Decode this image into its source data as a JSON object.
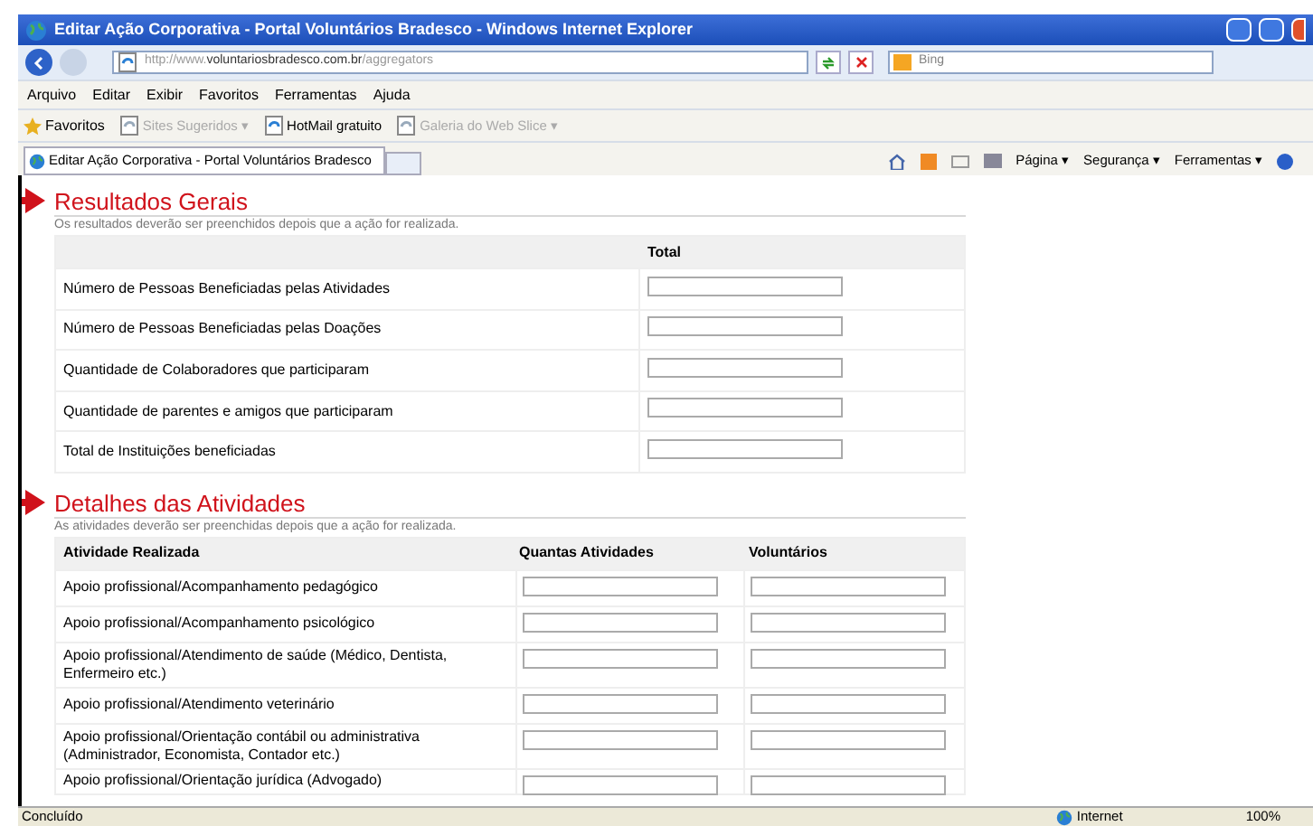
{
  "window": {
    "title": "Editar Ação Corporativa - Portal Voluntários Bradesco - Windows Internet Explorer"
  },
  "address": {
    "prefix": "http://www.",
    "domain": "voluntariosbradesco.com.br",
    "path": "/aggregators"
  },
  "search": {
    "placeholder": "Bing"
  },
  "menu": [
    "Arquivo",
    "Editar",
    "Exibir",
    "Favoritos",
    "Ferramentas",
    "Ajuda"
  ],
  "favorites_bar": {
    "label": "Favoritos",
    "items": [
      {
        "label": "Sites Sugeridos ▾",
        "disabled": true
      },
      {
        "label": "HotMail gratuito",
        "disabled": false
      },
      {
        "label": "Galeria do Web Slice ▾",
        "disabled": true
      }
    ]
  },
  "tab": {
    "title": "Editar Ação Corporativa - Portal Voluntários Bradesco"
  },
  "command_bar": [
    "Página ▾",
    "Segurança ▾",
    "Ferramentas ▾"
  ],
  "sections": [
    {
      "title": "Resultados Gerais",
      "subtitle": "Os resultados deverão ser preenchidos depois que a ação for realizada.",
      "columns": [
        "",
        "Total"
      ],
      "rows": [
        {
          "label": "Número de Pessoas Beneficiadas pelas Atividades"
        },
        {
          "label": "Número de Pessoas Beneficiadas pelas Doações"
        },
        {
          "label": "Quantidade de Colaboradores que participaram"
        },
        {
          "label": "Quantidade de parentes e amigos que participaram"
        },
        {
          "label": "Total de Instituições beneficiadas"
        }
      ]
    },
    {
      "title": "Detalhes das Atividades",
      "subtitle": "As atividades deverão ser preenchidas depois que a ação for realizada.",
      "columns": [
        "Atividade Realizada",
        "Quantas Atividades",
        "Voluntários"
      ],
      "rows": [
        {
          "label": "Apoio profissional/Acompanhamento pedagógico"
        },
        {
          "label": "Apoio profissional/Acompanhamento psicológico"
        },
        {
          "label": "Apoio profissional/Atendimento de saúde (Médico, Dentista, Enfermeiro etc.)"
        },
        {
          "label": "Apoio profissional/Atendimento veterinário"
        },
        {
          "label": "Apoio profissional/Orientação contábil ou administrativa (Administrador, Economista, Contador etc.)"
        },
        {
          "label": "Apoio profissional/Orientação jurídica (Advogado)"
        }
      ]
    }
  ],
  "status_bar": {
    "text": "Concluído",
    "zone": "Internet",
    "zoom": "100%"
  }
}
